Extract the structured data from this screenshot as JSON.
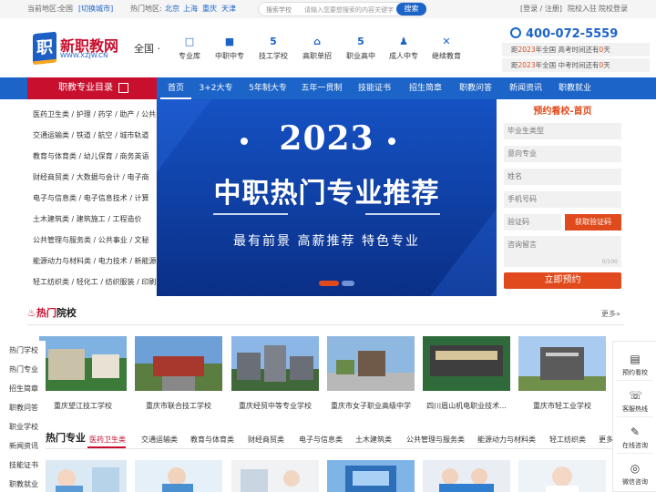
{
  "topbar": {
    "current_area_label": "当前地区:",
    "current_area": "全国",
    "switch_city": "[切换城市]",
    "hot_label": "热门地区:",
    "hot_cities": [
      "北京",
      "上海",
      "重庆",
      "天津"
    ],
    "search_select": "搜索学校",
    "search_placeholder": "请输入您要想搜索的内容关键字",
    "search_button": "搜索",
    "login": "[登录 / 注册]",
    "school_join": "院校入驻",
    "school_login": "院校登录"
  },
  "header": {
    "logo_mark": "职",
    "logo_text": "新职教网",
    "logo_sub": "WWW.XZJW.CN",
    "region": "全国",
    "nav": [
      {
        "icon": "□",
        "label": "专业库"
      },
      {
        "icon": "■",
        "label": "中职中专"
      },
      {
        "icon": "5",
        "label": "技工学校"
      },
      {
        "icon": "⌂",
        "label": "高职单招"
      },
      {
        "icon": "5",
        "label": "职业高中"
      },
      {
        "icon": "♟",
        "label": "成人中专"
      },
      {
        "icon": "✕",
        "label": "继续教育"
      }
    ],
    "phone": "400-072-5559",
    "countdown": [
      {
        "pre": "距",
        "year": "2023",
        "mid": "年全国 高考时间还有",
        "days": "0",
        "suf": "天"
      },
      {
        "pre": "距",
        "year": "2023",
        "mid": "年全国 中考时间还有",
        "days": "0",
        "suf": "天"
      }
    ]
  },
  "mainnav": {
    "category_button": "职教专业目录",
    "items": [
      "首页",
      "3+2大专",
      "5年制大专",
      "五年一贯制",
      "技能证书",
      "招生简章",
      "职教问答",
      "新闻资讯",
      "职教就业"
    ],
    "active": "首页"
  },
  "categories": [
    "医药卫生类 / 护理 / 药学 / 助产 / 公共",
    "交通运输类 / 铁道 / 航空 / 城市轨道",
    "教育与体育类 / 幼儿保育 / 商务英语",
    "财经商贸类 / 大数据与会计 / 电子商",
    "电子与信息类 / 电子信息技术 / 计算",
    "土木建筑类 / 建筑施工 / 工程造价",
    "公共管理与服务类 / 公共事业 / 文秘",
    "能源动力与材料类 / 电力技术 / 新能源",
    "轻工纺织类 / 轻化工 / 纺织服装 / 印刷"
  ],
  "banner": {
    "year": "2023",
    "title": "中职热门专业推荐",
    "subtitle": "最有前景 高薪推荐 特色专业"
  },
  "form": {
    "title": "预约看校-首页",
    "grad_type_placeholder": "毕业生类型",
    "school_placeholder": "意向专业",
    "name_placeholder": "姓名",
    "phone_placeholder": "手机号码",
    "code_placeholder": "验证码",
    "code_button": "获取验证码",
    "message_placeholder": "咨询留言",
    "message_count": "0/100",
    "submit": "立即预约"
  },
  "hot_schools": {
    "title_red": "热门",
    "title_black": "院校",
    "more": "更多»",
    "schools": [
      {
        "name": "重庆望江技工学校",
        "colors": [
          "#7fb2e0",
          "#3c7a3a",
          "#c9c1a8"
        ]
      },
      {
        "name": "重庆市联合技工学校",
        "colors": [
          "#6ea0d8",
          "#a8382e",
          "#5b7d3f"
        ]
      },
      {
        "name": "重庆经贸中等专业学校",
        "colors": [
          "#8bb6e6",
          "#6a6f77",
          "#40683a"
        ]
      },
      {
        "name": "重庆市女子职业高级中学",
        "colors": [
          "#8fb8e0",
          "#6f5a4a",
          "#b8b8b8"
        ]
      },
      {
        "name": "四川眉山机电职业技术...",
        "colors": [
          "#9fbfe0",
          "#3e3e3e",
          "#2f6b3a"
        ]
      },
      {
        "name": "重庆市轻工业学校",
        "colors": [
          "#a9cbef",
          "#5b5b5b",
          "#6f8f4a"
        ]
      }
    ]
  },
  "left_float": [
    "热门学校",
    "热门专业",
    "招生简章",
    "职教问答",
    "职业学校",
    "新闻资讯",
    "技能证书",
    "职教就业"
  ],
  "hot_majors": {
    "title": "热门专业",
    "tabs": [
      "医药卫生类",
      "交通运输类",
      "教育与体育类",
      "财经商贸类",
      "电子与信息类",
      "土木建筑类",
      "公共管理与服务类",
      "能源动力与材料类",
      "轻工纺织类",
      "更多"
    ],
    "active": "医药卫生类"
  },
  "right_float": [
    {
      "icon": "▤",
      "label": "预约看校"
    },
    {
      "icon": "☏",
      "label": "客服热线"
    },
    {
      "icon": "✎",
      "label": "在线咨询"
    },
    {
      "icon": "◎",
      "label": "微信咨询"
    }
  ],
  "colors": {
    "brand_blue": "#1c64c8",
    "brand_red": "#c8102e",
    "accent_orange": "#e04a1c"
  }
}
